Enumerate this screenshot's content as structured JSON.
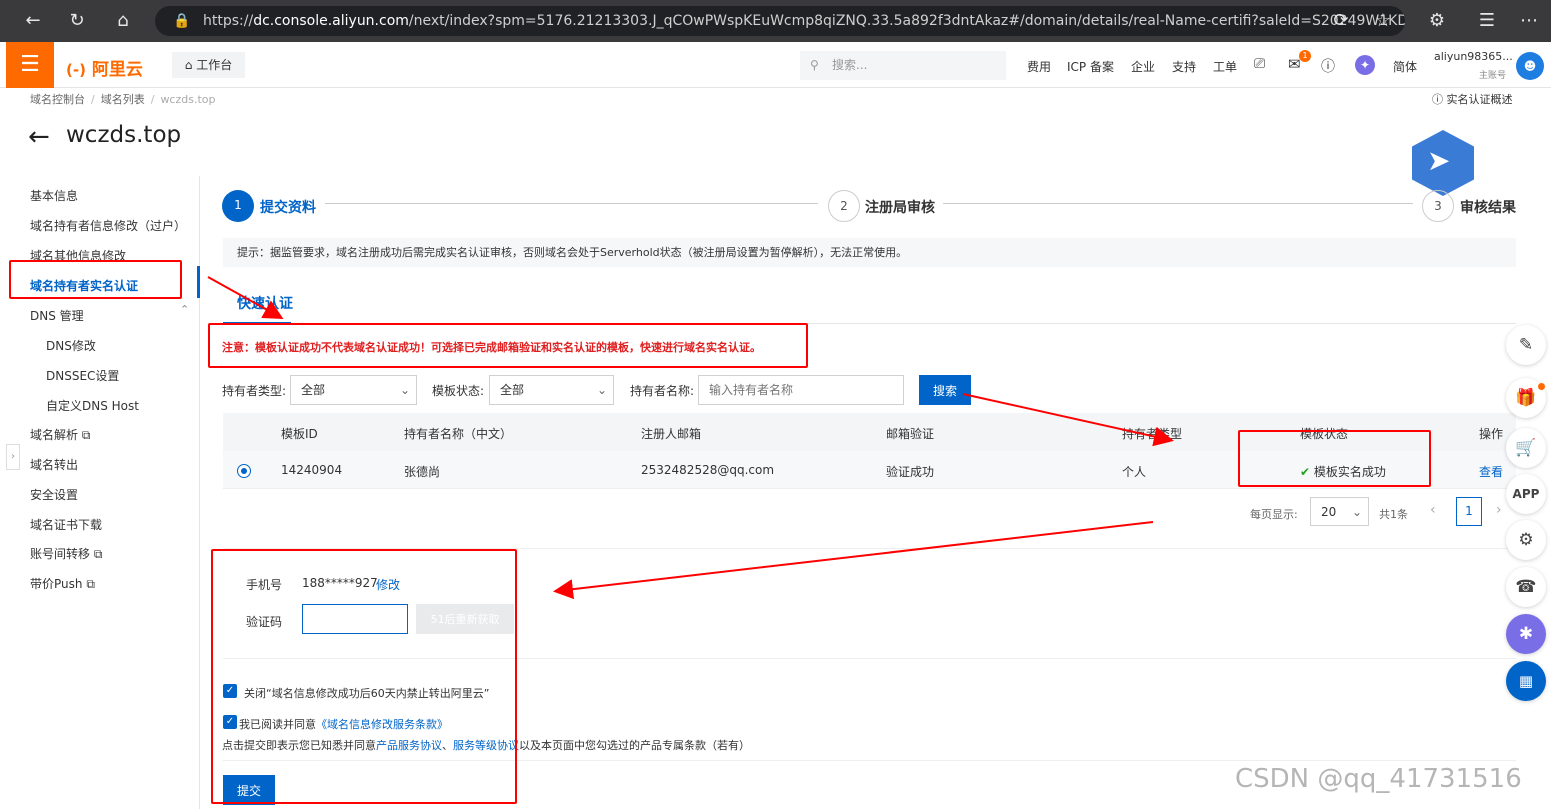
{
  "browser": {
    "url_prefix": "https://",
    "url_host": "dc.console.aliyun.com",
    "url_rest": "/next/index?spm=5176.21213303.J_qCOwPWspKEuWcmp8qiZNQ.33.5a892f3dntAkaz#/domain/details/real-Name-certifi?saleId=S20249W1KD..."
  },
  "topnav": {
    "logo": "阿里云",
    "workbench": "工作台",
    "search_placeholder": "搜索...",
    "items": [
      "费用",
      "ICP 备案",
      "企业",
      "支持",
      "工单"
    ],
    "notification_count": "1",
    "lang": "简体",
    "account": "aliyun98365...",
    "account_role": "主账号"
  },
  "breadcrumb": [
    "域名控制台",
    "域名列表",
    "wczds.top"
  ],
  "help_link": "实名认证概述",
  "page_title": "wczds.top",
  "sidebar": {
    "items": [
      "基本信息",
      "域名持有者信息修改（过户）",
      "域名其他信息修改",
      "域名持有者实名认证",
      "DNS 管理",
      "DNS修改",
      "DNSSEC设置",
      "自定义DNS Host",
      "域名解析",
      "域名转出",
      "安全设置",
      "域名证书下载",
      "账号间转移",
      "带价Push"
    ]
  },
  "steps": [
    {
      "num": "1",
      "label": "提交资料"
    },
    {
      "num": "2",
      "label": "注册局审核"
    },
    {
      "num": "3",
      "label": "审核结果"
    }
  ],
  "notice": "提示：据监管要求，域名注册成功后需完成实名认证审核，否则域名会处于Serverhold状态（被注册局设置为暂停解析），无法正常使用。",
  "tab": "快速认证",
  "warning": "注意：模板认证成功不代表域名认证成功！可选择已完成邮箱验证和实名认证的模板，快速进行域名实名认证。",
  "filters": {
    "holder_type_label": "持有者类型:",
    "holder_type_value": "全部",
    "template_status_label": "模板状态:",
    "template_status_value": "全部",
    "holder_name_label": "持有者名称:",
    "holder_name_placeholder": "输入持有者名称",
    "search_button": "搜索"
  },
  "table": {
    "headers": [
      "模板ID",
      "持有者名称（中文）",
      "注册人邮箱",
      "邮箱验证",
      "持有者类型",
      "模板状态",
      "操作"
    ],
    "rows": [
      {
        "id": "14240904",
        "name": "张德尚",
        "email": "2532482528@qq.com",
        "email_verify": "验证成功",
        "type": "个人",
        "status": "模板实名成功",
        "action": "查看"
      }
    ]
  },
  "pager": {
    "per_page_label": "每页显示:",
    "per_page": "20",
    "total": "共1条",
    "page": "1"
  },
  "verify": {
    "phone_label": "手机号",
    "phone": "188*****927",
    "modify": "修改",
    "code_label": "验证码",
    "resend": "51后重新获取"
  },
  "agreements": {
    "check1": "关闭“域名信息修改成功后60天内禁止转出阿里云”",
    "check2_prefix": "我已阅读并同意",
    "check2_link": "《域名信息修改服务条款》",
    "line3_prefix": "点击提交即表示您已知悉并同意",
    "line3_link1": "产品服务协议",
    "line3_sep": "、",
    "line3_link2": "服务等级协议",
    "line3_suffix": "以及本页面中您勾选过的产品专属条款（若有）"
  },
  "submit": "提交",
  "watermark": "CSDN @qq_41731516",
  "colors": {
    "brand": "#ff6a00",
    "primary": "#0064c8",
    "annotation": "#ff0000",
    "success": "#21a121"
  }
}
